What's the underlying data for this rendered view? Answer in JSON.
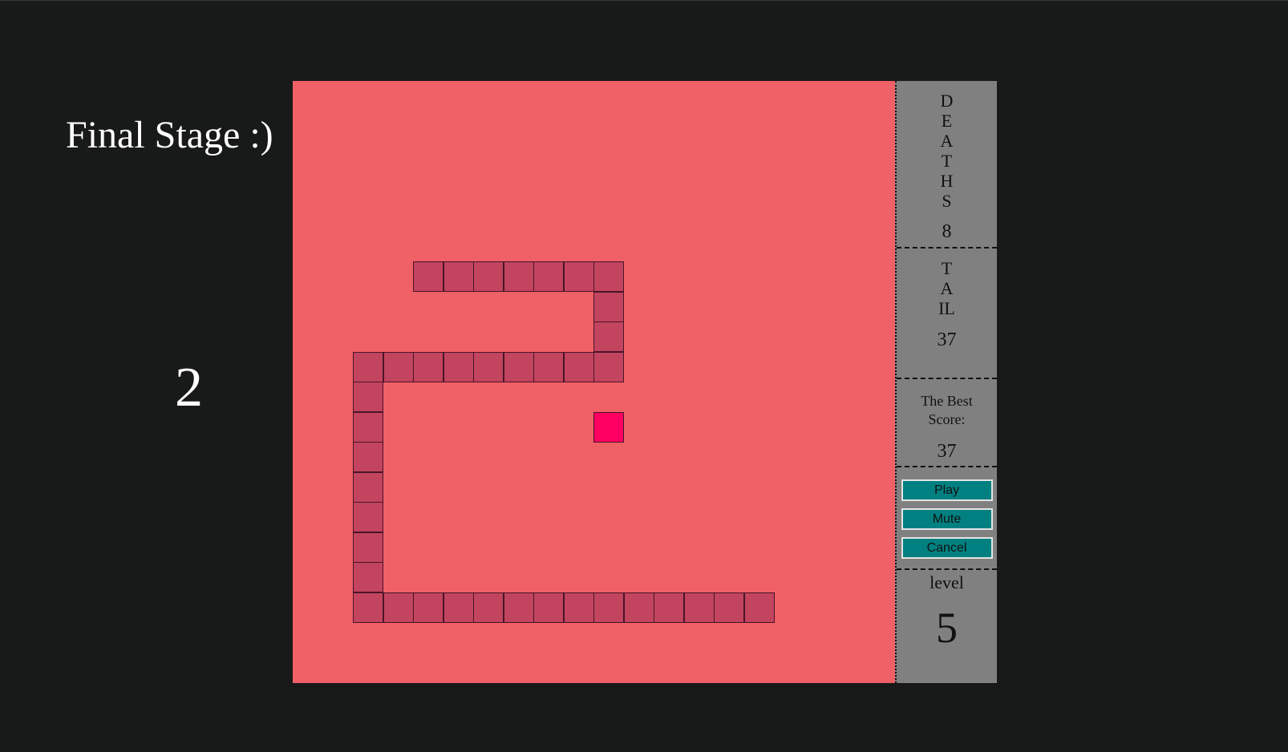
{
  "stage": {
    "title": "Final Stage :)",
    "countdown": "2"
  },
  "board": {
    "background_color": "#ef6067",
    "snake_color": "#c2445e",
    "food_color": "#ff0062",
    "snake_cells": [
      [
        4,
        6
      ],
      [
        5,
        6
      ],
      [
        6,
        6
      ],
      [
        7,
        6
      ],
      [
        8,
        6
      ],
      [
        9,
        6
      ],
      [
        10,
        6
      ],
      [
        10,
        7
      ],
      [
        10,
        8
      ],
      [
        10,
        9
      ],
      [
        9,
        9
      ],
      [
        8,
        9
      ],
      [
        7,
        9
      ],
      [
        6,
        9
      ],
      [
        5,
        9
      ],
      [
        4,
        9
      ],
      [
        3,
        9
      ],
      [
        2,
        9
      ],
      [
        2,
        10
      ],
      [
        2,
        11
      ],
      [
        2,
        12
      ],
      [
        2,
        13
      ],
      [
        2,
        14
      ],
      [
        2,
        15
      ],
      [
        2,
        16
      ],
      [
        2,
        17
      ],
      [
        3,
        17
      ],
      [
        4,
        17
      ],
      [
        5,
        17
      ],
      [
        6,
        17
      ],
      [
        7,
        17
      ],
      [
        8,
        17
      ],
      [
        9,
        17
      ],
      [
        10,
        17
      ],
      [
        11,
        17
      ],
      [
        12,
        17
      ],
      [
        13,
        17
      ],
      [
        14,
        17
      ],
      [
        15,
        17
      ]
    ],
    "food_cell": [
      10,
      11
    ]
  },
  "panel": {
    "deaths_label": "DEATHS",
    "deaths_value": "8",
    "tail_label": "TAIL",
    "tail_value": "37",
    "best_label": "The Best Score:",
    "best_value": "37",
    "play_label": "Play",
    "mute_label": "Mute",
    "cancel_label": "Cancel",
    "level_label": "level",
    "level_value": "5"
  }
}
